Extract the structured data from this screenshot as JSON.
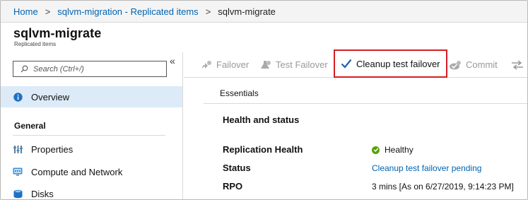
{
  "breadcrumb": {
    "items": [
      "Home",
      "sqlvm-migration - Replicated items",
      "sqlvm-migrate"
    ]
  },
  "header": {
    "title": "sqlvm-migrate",
    "subtitle": "Replicated items"
  },
  "sidebar": {
    "collapse_glyph": "«",
    "search_placeholder": "Search (Ctrl+/)",
    "overview_label": "Overview",
    "section_general": "General",
    "items": [
      {
        "label": "Properties",
        "icon": "properties-icon"
      },
      {
        "label": "Compute and Network",
        "icon": "compute-network-icon"
      },
      {
        "label": "Disks",
        "icon": "disks-icon"
      }
    ]
  },
  "toolbar": {
    "failover": "Failover",
    "test_failover": "Test Failover",
    "cleanup_test_failover": "Cleanup test failover",
    "commit": "Commit",
    "highlight_color": "#d41e24"
  },
  "main": {
    "essentials_label": "Essentials",
    "health_title": "Health and status",
    "rows": [
      {
        "label": "Replication Health",
        "value": "Healthy"
      },
      {
        "label": "Status",
        "value": "Cleanup test failover pending"
      },
      {
        "label": "RPO",
        "value": "3 mins [As on 6/27/2019, 9:14:23 PM]"
      }
    ]
  },
  "colors": {
    "link": "#0063b1",
    "selected_nav": "#dcebf7",
    "healthy": "#57a300"
  }
}
